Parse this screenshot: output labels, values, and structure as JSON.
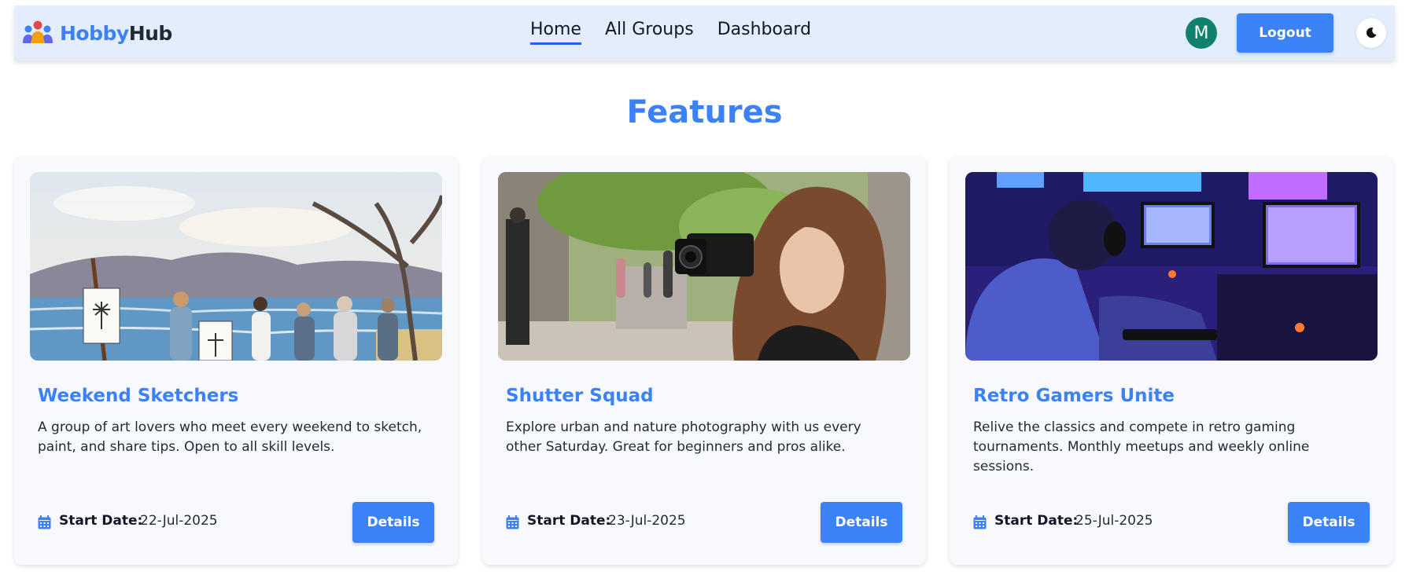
{
  "brand": {
    "part1": "Hobby",
    "part2": "Hub",
    "icon": "people-group-icon"
  },
  "nav": {
    "links": [
      "Home",
      "All Groups",
      "Dashboard"
    ],
    "active": "Home"
  },
  "user": {
    "avatar_initial": "M",
    "avatar_color": "#10826b"
  },
  "header": {
    "logout_label": "Logout",
    "theme_icon": "moon-icon"
  },
  "colors": {
    "accent": "#3b82f6",
    "navbar_bg": "#e3edfc"
  },
  "features": {
    "title": "Features",
    "cards": [
      {
        "title": "Weekend Sketchers",
        "description": "A group of art lovers who meet every weekend to sketch, paint, and share tips. Open to all skill levels.",
        "date_label": "Start Date:",
        "date": "22-Jul-2025",
        "button": "Details",
        "image": "watercolor painting of people sketching by a lake"
      },
      {
        "title": "Shutter Squad",
        "description": "Explore urban and nature photography with us every other Saturday. Great for beginners and pros alike.",
        "date_label": "Start Date:",
        "date": "23-Jul-2025",
        "button": "Details",
        "image": "woman taking a photo with a camera on a city street"
      },
      {
        "title": "Retro Gamers Unite",
        "description": "Relive the classics and compete in retro gaming tournaments. Monthly meetups and weekly online sessions.",
        "date_label": "Start Date:",
        "date": "25-Jul-2025",
        "button": "Details",
        "image": "gamers playing in a neon-lit gaming room"
      }
    ]
  }
}
